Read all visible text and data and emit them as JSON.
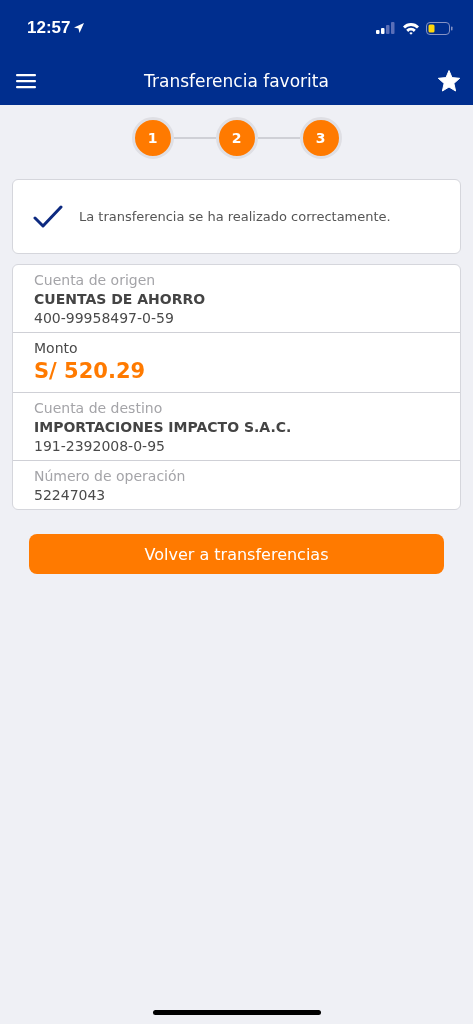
{
  "status_bar": {
    "time": "12:57"
  },
  "nav": {
    "title": "Transferencia favorita"
  },
  "steps": [
    {
      "label": "1",
      "done": true
    },
    {
      "label": "2",
      "done": true
    },
    {
      "label": "3",
      "done": true
    }
  ],
  "message": "La transferencia se ha realizado correctamente.",
  "details": [
    {
      "label": "Cuenta de origen",
      "kind": "muted",
      "values": [
        {
          "kind": "name",
          "text": "CUENTAS DE AHORRO"
        },
        {
          "kind": "number",
          "text": "400-99958497-0-59"
        }
      ]
    },
    {
      "label": "Monto",
      "kind": "strong",
      "values": [
        {
          "kind": "amount",
          "text": "S/ 520.29"
        }
      ]
    },
    {
      "label": "Cuenta de destino",
      "kind": "muted",
      "values": [
        {
          "kind": "name",
          "text": "IMPORTACIONES IMPACTO S.A.C."
        },
        {
          "kind": "number",
          "text": "191-2392008-0-95"
        }
      ]
    },
    {
      "label": "Número de operación",
      "kind": "muted",
      "values": [
        {
          "kind": "number",
          "text": "52247043"
        }
      ]
    }
  ],
  "button": "Volver a transferencias"
}
